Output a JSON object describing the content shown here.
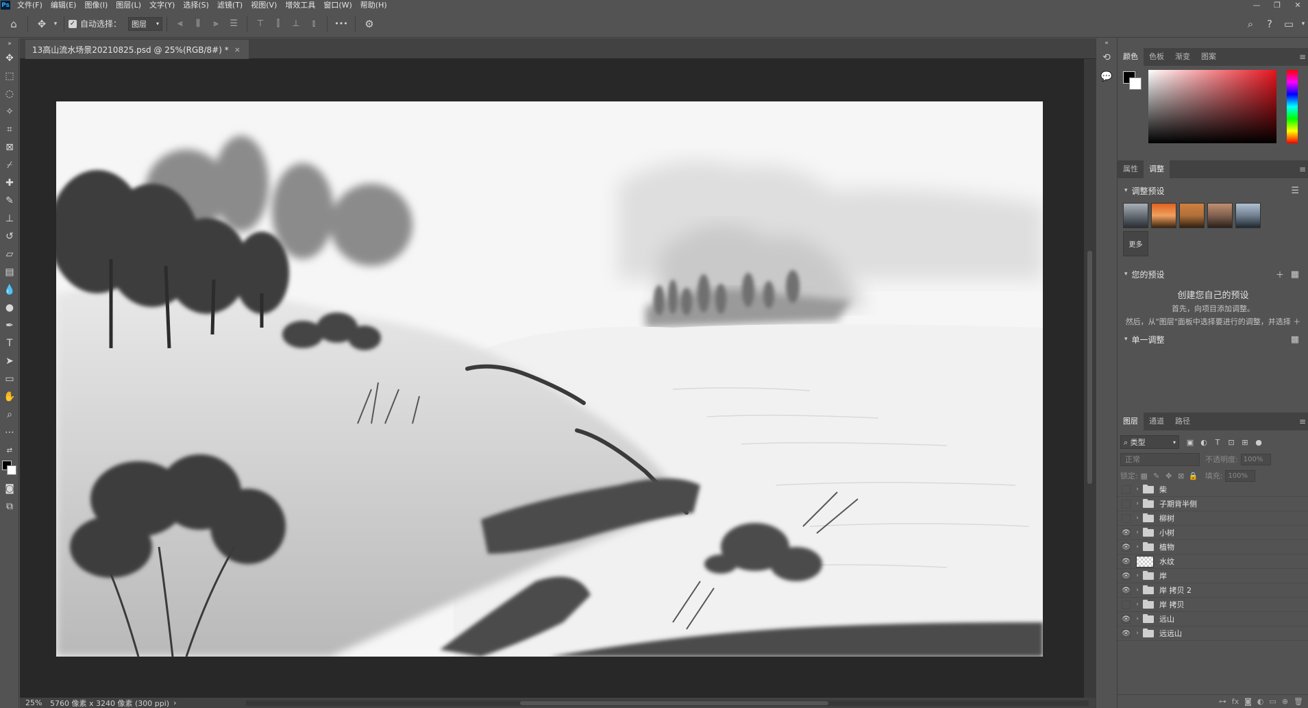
{
  "menu": {
    "app_logo": "Ps",
    "items": [
      "文件(F)",
      "编辑(E)",
      "图像(I)",
      "图层(L)",
      "文字(Y)",
      "选择(S)",
      "滤镜(T)",
      "视图(V)",
      "增效工具",
      "窗口(W)",
      "帮助(H)"
    ]
  },
  "options": {
    "auto_select_label": "自动选择：",
    "layer_select_value": "图层",
    "more_label": "•••"
  },
  "document": {
    "tab_title": "13高山流水场景20210825.psd @ 25%(RGB/8#) *",
    "close_label": "×"
  },
  "status": {
    "zoom": "25%",
    "info": "5760 像素 x 3240 像素 (300 ppi)",
    "arrow": "›"
  },
  "color_panel": {
    "tabs": [
      "颜色",
      "色板",
      "渐变",
      "图案"
    ],
    "foreground": "#000000",
    "background": "#ffffff"
  },
  "adjust_panel": {
    "tabs": [
      "属性",
      "调整"
    ],
    "presets_title": "调整预设",
    "more_label": "更多",
    "your_presets_title": "您的预设",
    "create_title": "创建您自己的预设",
    "desc1": "首先，向项目添加调整。",
    "desc2": "然后，从\"图层\"面板中选择要进行的调整，并选择 ＋",
    "single_adjust_title": "单一调整"
  },
  "layers_panel": {
    "tabs": [
      "图层",
      "通道",
      "路径"
    ],
    "filter_kind": "类型",
    "blend_mode": "正常",
    "opacity_label": "不透明度:",
    "opacity_value": "100%",
    "lock_label": "锁定:",
    "fill_label": "填充:",
    "fill_value": "100%",
    "layers": [
      {
        "name": "柴",
        "visible": false,
        "type": "group"
      },
      {
        "name": "子期背半侧",
        "visible": false,
        "type": "group"
      },
      {
        "name": "柳树",
        "visible": false,
        "type": "group"
      },
      {
        "name": "小树",
        "visible": true,
        "type": "group"
      },
      {
        "name": "植物",
        "visible": true,
        "type": "group"
      },
      {
        "name": "水纹",
        "visible": true,
        "type": "pixel"
      },
      {
        "name": "岸",
        "visible": true,
        "type": "group"
      },
      {
        "name": "岸 拷贝 2",
        "visible": true,
        "type": "group"
      },
      {
        "name": "岸 拷贝",
        "visible": false,
        "type": "group"
      },
      {
        "name": "远山",
        "visible": true,
        "type": "group"
      },
      {
        "name": "远远山",
        "visible": true,
        "type": "group"
      }
    ]
  }
}
